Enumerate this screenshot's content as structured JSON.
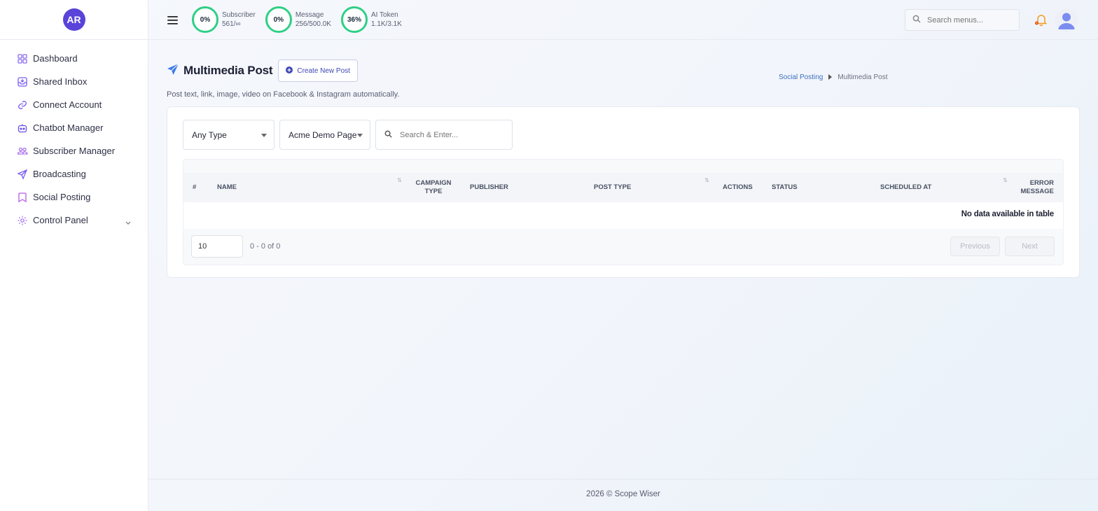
{
  "brand": {
    "initials": "AR"
  },
  "sidebar": {
    "items": [
      {
        "label": "Dashboard",
        "icon": "dashboard-icon"
      },
      {
        "label": "Shared Inbox",
        "icon": "inbox-icon"
      },
      {
        "label": "Connect Account",
        "icon": "link-icon"
      },
      {
        "label": "Chatbot Manager",
        "icon": "bot-icon"
      },
      {
        "label": "Subscriber Manager",
        "icon": "users-icon"
      },
      {
        "label": "Broadcasting",
        "icon": "send-icon"
      },
      {
        "label": "Social Posting",
        "icon": "bookmark-icon"
      },
      {
        "label": "Control Panel",
        "icon": "gear-icon"
      }
    ]
  },
  "topbar": {
    "stats": [
      {
        "percent": "0%",
        "label": "Subscriber",
        "value": "561/∞"
      },
      {
        "percent": "0%",
        "label": "Message",
        "value": "256/500.0K"
      },
      {
        "percent": "36%",
        "label": "AI Token",
        "value": "1.1K/3.1K"
      }
    ],
    "search_placeholder": "Search menus...",
    "accent_ring": "#2fcf84",
    "bell_color": "#f39c1f"
  },
  "page": {
    "title": "Multimedia Post",
    "create_button": "Create New Post",
    "subtitle": "Post text, link, image, video on Facebook & Instagram automatically.",
    "breadcrumb": {
      "parent": "Social Posting",
      "current": "Multimedia Post"
    }
  },
  "filters": {
    "type_selected": "Any Type",
    "page_selected": "Acme Demo Page",
    "search_placeholder": "Search & Enter..."
  },
  "table": {
    "columns": [
      "#",
      "NAME",
      "CAMPAIGN TYPE",
      "PUBLISHER",
      "POST TYPE",
      "ACTIONS",
      "STATUS",
      "SCHEDULED AT",
      "ERROR MESSAGE"
    ],
    "col_campaign_1": "CAMPAIGN",
    "col_campaign_2": "TYPE",
    "col_error_1": "ERROR",
    "col_error_2": "MESSAGE",
    "empty_message": "No data available in table",
    "page_length": "10",
    "range": "0 - 0 of 0",
    "prev_label": "Previous",
    "next_label": "Next"
  },
  "footer": {
    "text": "2026 © Scope Wiser"
  }
}
